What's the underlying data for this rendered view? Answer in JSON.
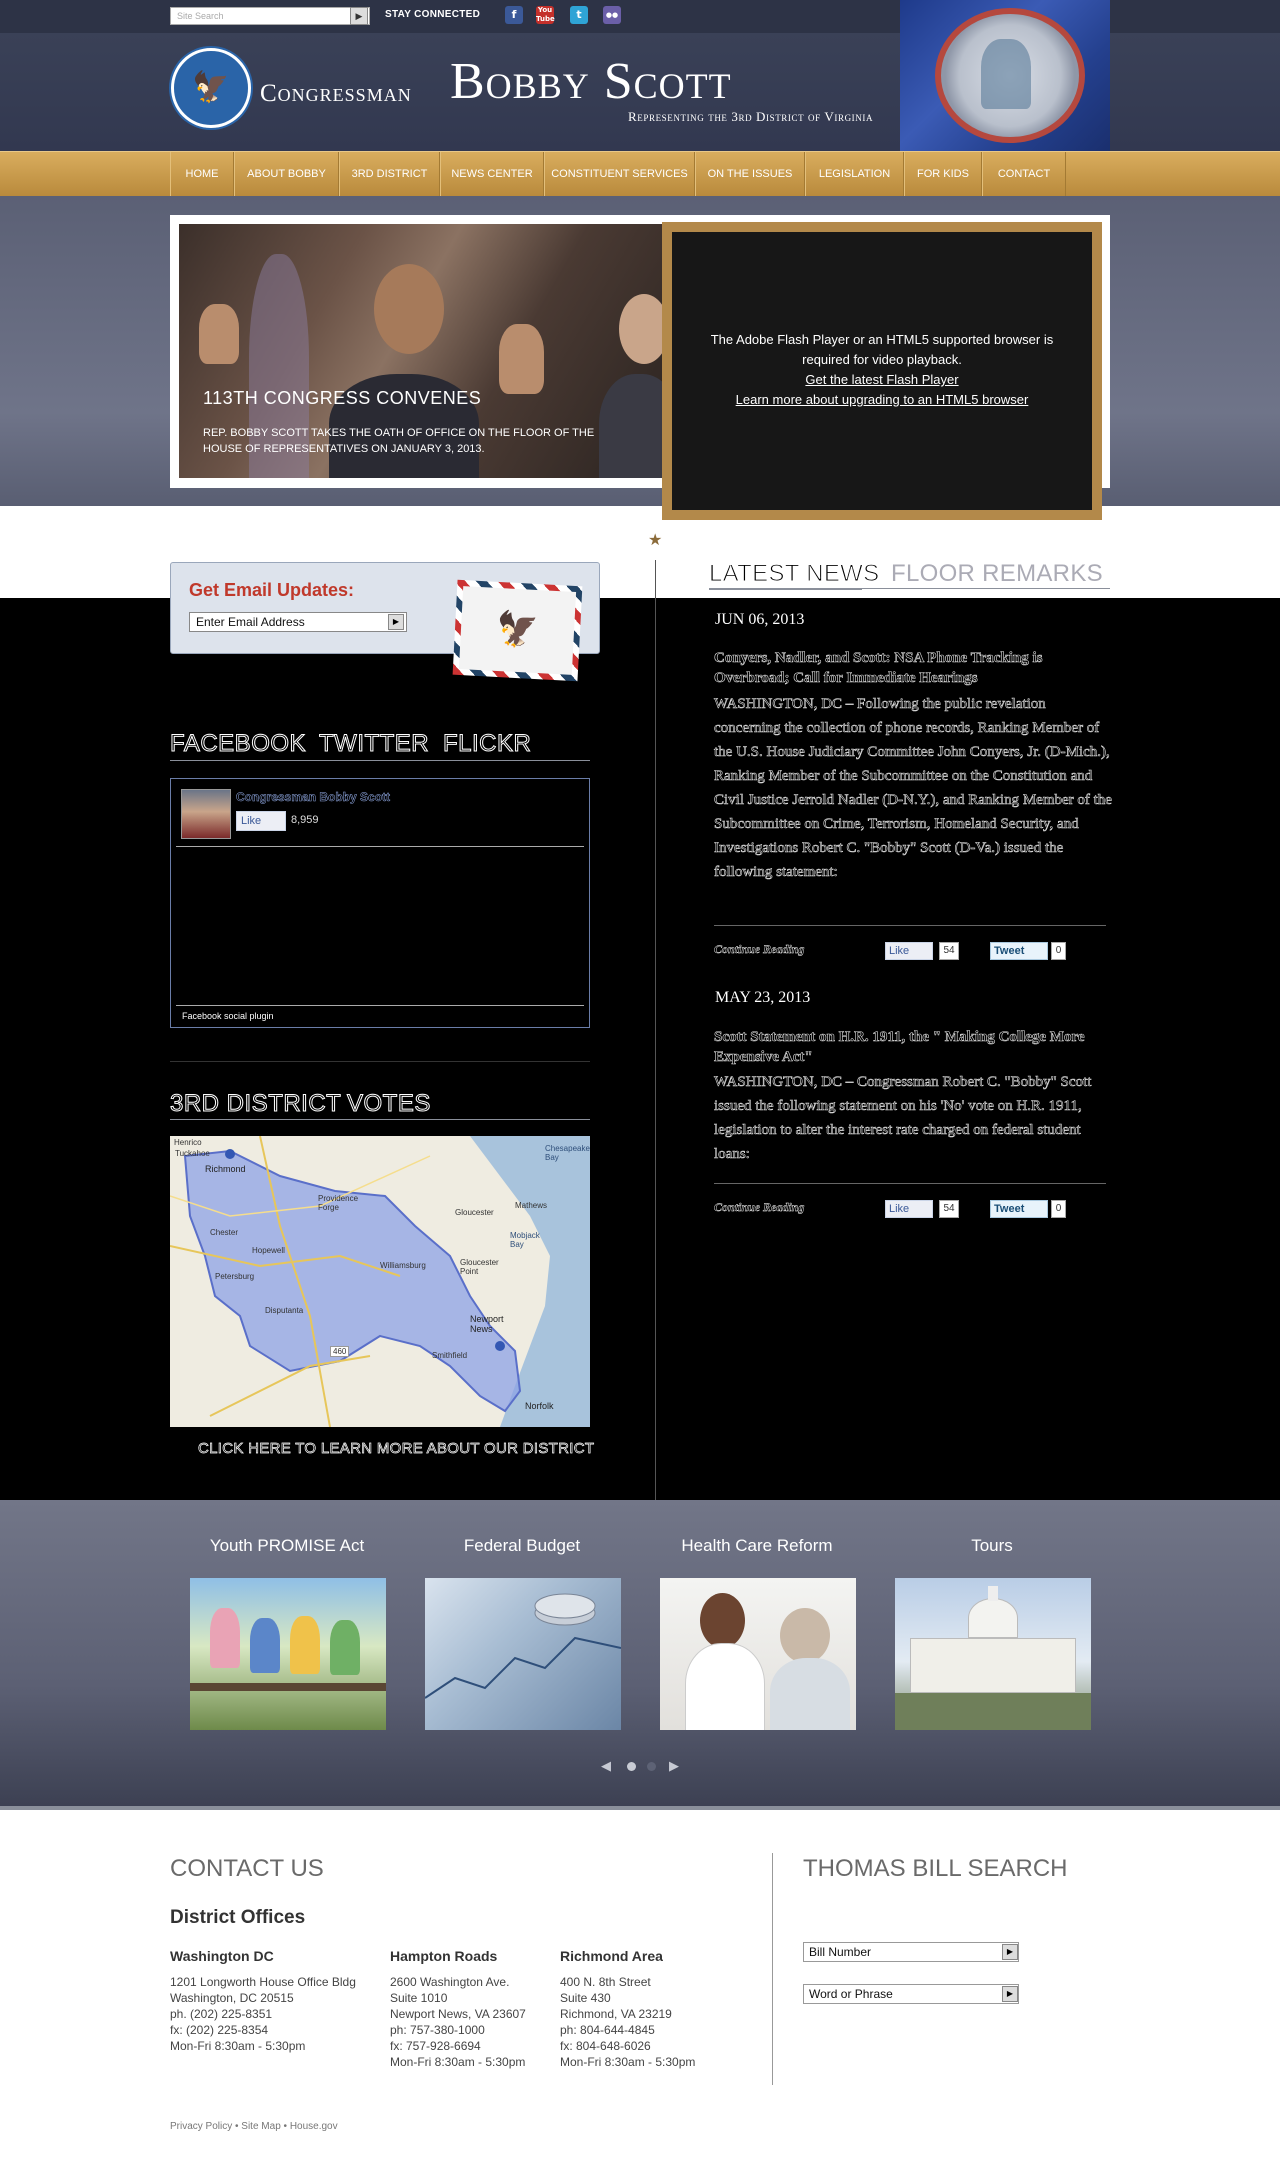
{
  "topbar": {
    "search_placeholder": "Site Search",
    "search_go": "▶",
    "stay_connected": "STAY CONNECTED",
    "social": [
      {
        "name": "facebook",
        "glyph": "f",
        "color": "#3b5998"
      },
      {
        "name": "youtube",
        "glyph": "You",
        "color": "#c4302b"
      },
      {
        "name": "twitter",
        "glyph": "t",
        "color": "#2fa4d6"
      },
      {
        "name": "flickr",
        "glyph": "●●",
        "color": "#6b5fa8"
      }
    ]
  },
  "header": {
    "congressman": "Congressman",
    "name": "Bobby Scott",
    "subtitle": "Representing the 3rd District of Virginia"
  },
  "nav": {
    "items": [
      {
        "label": "HOME"
      },
      {
        "label": "ABOUT BOBBY"
      },
      {
        "label": "3RD DISTRICT"
      },
      {
        "label": "NEWS CENTER"
      },
      {
        "label": "CONSTITUENT SERVICES"
      },
      {
        "label": "ON THE ISSUES"
      },
      {
        "label": "LEGISLATION"
      },
      {
        "label": "FOR KIDS"
      },
      {
        "label": "CONTACT"
      }
    ]
  },
  "hero": {
    "title": "113TH CONGRESS CONVENES",
    "text": "REP. BOBBY SCOTT TAKES THE OATH OF OFFICE ON THE FLOOR OF THE HOUSE OF REPRESENTATIVES ON JANUARY 3, 2013.",
    "video_msg1": "The Adobe Flash Player or an HTML5 supported browser is",
    "video_msg2": "required for video playback.",
    "video_link1": "Get the latest Flash Player",
    "video_link2": "Learn more about upgrading to an HTML5 browser"
  },
  "email": {
    "title": "Get Email Updates:",
    "placeholder": "Enter Email Address",
    "go": "▶"
  },
  "social_tabs": {
    "facebook": "FACEBOOK",
    "twitter": "TWITTER",
    "flickr": "FLICKR"
  },
  "fb_widget": {
    "page_name": "Congressman Bobby Scott",
    "like": "Like",
    "count": "8,959",
    "plugin": "Facebook social plugin"
  },
  "district_tabs": {
    "district": "3RD DISTRICT",
    "votes": "VOTES"
  },
  "map": {
    "cta": "CLICK HERE TO LEARN MORE ABOUT OUR DISTRICT",
    "labels": {
      "henrico": "Henrico",
      "tuckahoe": "Tuckahoe",
      "richmond": "Richmond",
      "chester": "Chester",
      "hopewell": "Hopewell",
      "petersburg": "Petersburg",
      "providence": "Providence Forge",
      "williamsburg": "Williamsburg",
      "gloucester": "Gloucester",
      "gloucester_point": "Gloucester Point",
      "mathews": "Mathews",
      "mobjack": "Mobjack Bay",
      "chesapeake": "Chesapeake Bay",
      "newport": "Newport News",
      "smithfield": "Smithfield",
      "norfolk": "Norfolk",
      "dendron": "Disputanta",
      "route": "460"
    }
  },
  "news": {
    "tab_latest": "LATEST NEWS",
    "tab_floor": "FLOOR REMARKS",
    "items": [
      {
        "date": "JUN 06, 2013",
        "headline": "Conyers, Nadler, and Scott: NSA Phone Tracking is Overbroad; Call for Immediate Hearings",
        "body": "WASHINGTON, DC – Following the public revelation concerning the collection of phone records, Ranking Member of the U.S. House Judiciary Committee John Conyers, Jr. (D-Mich.), Ranking Member of the Subcommittee on the Constitution and Civil Justice Jerrold Nadler (D-N.Y.), and Ranking Member of the Subcommittee on Crime, Terrorism, Homeland Security, and Investigations Robert C. \"Bobby\" Scott (D-Va.) issued the following statement:",
        "more": "Continue Reading",
        "like": "Like",
        "like_count": "54",
        "tweet": "Tweet",
        "tweet_count": "0"
      },
      {
        "date": "MAY 23, 2013",
        "headline": "Scott Statement on H.R. 1911, the \" Making College More Expensive Act\"",
        "body": "WASHINGTON, DC – Congressman Robert C. \"Bobby\" Scott issued the following statement on his 'No' vote on H.R. 1911, legislation to alter the interest rate charged on federal student loans:",
        "more": "Continue Reading",
        "like": "Like",
        "like_count": "54",
        "tweet": "Tweet",
        "tweet_count": "0"
      }
    ]
  },
  "features": {
    "items": [
      {
        "title": "Youth PROMISE Act"
      },
      {
        "title": "Federal Budget"
      },
      {
        "title": "Health Care Reform"
      },
      {
        "title": "Tours"
      }
    ],
    "prev": "◀",
    "next": "▶"
  },
  "footer": {
    "contact_title": "CONTACT US",
    "offices_title": "District Offices",
    "offices": [
      {
        "name": "Washington DC",
        "lines": [
          "1201 Longworth House Office Bldg",
          "Washington, DC 20515",
          "ph. (202) 225-8351",
          "fx: (202) 225-8354",
          "Mon-Fri 8:30am - 5:30pm"
        ]
      },
      {
        "name": "Hampton Roads",
        "lines": [
          "2600 Washington Ave.",
          "Suite 1010",
          "Newport News, VA 23607",
          "ph: 757-380-1000",
          "fx: 757-928-6694",
          "Mon-Fri 8:30am - 5:30pm"
        ]
      },
      {
        "name": "Richmond Area",
        "lines": [
          "400 N. 8th Street",
          "Suite 430",
          "Richmond, VA 23219",
          "ph: 804-644-4845",
          "fx: 804-648-6026",
          "Mon-Fri 8:30am - 5:30pm"
        ]
      }
    ],
    "thomas_title": "THOMAS BILL SEARCH",
    "bill_number": "Bill Number",
    "word_phrase": "Word or Phrase",
    "go": "▶",
    "links": "Privacy Policy • Site Map • House.gov"
  }
}
